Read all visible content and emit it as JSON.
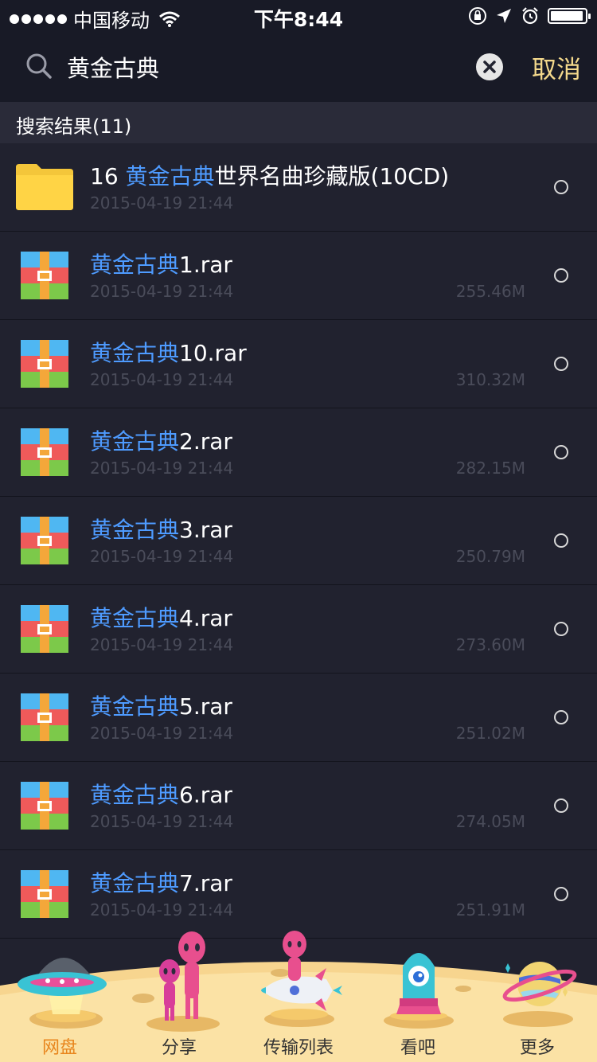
{
  "status_bar": {
    "carrier": "中国移动",
    "time": "下午8:44",
    "battery_level": 0.95
  },
  "search": {
    "query": "黄金古典",
    "cancel_label": "取消"
  },
  "results": {
    "header": "搜索结果(11)"
  },
  "files": [
    {
      "prefix": "16 ",
      "highlight": "黄金古典",
      "suffix": "世界名曲珍藏版(10CD)",
      "date": "2015-04-19 21:44",
      "size": "",
      "type": "folder"
    },
    {
      "prefix": "",
      "highlight": "黄金古典",
      "suffix": "1.rar",
      "date": "2015-04-19 21:44",
      "size": "255.46M",
      "type": "rar"
    },
    {
      "prefix": "",
      "highlight": "黄金古典",
      "suffix": "10.rar",
      "date": "2015-04-19 21:44",
      "size": "310.32M",
      "type": "rar"
    },
    {
      "prefix": "",
      "highlight": "黄金古典",
      "suffix": "2.rar",
      "date": "2015-04-19 21:44",
      "size": "282.15M",
      "type": "rar"
    },
    {
      "prefix": "",
      "highlight": "黄金古典",
      "suffix": "3.rar",
      "date": "2015-04-19 21:44",
      "size": "250.79M",
      "type": "rar"
    },
    {
      "prefix": "",
      "highlight": "黄金古典",
      "suffix": "4.rar",
      "date": "2015-04-19 21:44",
      "size": "273.60M",
      "type": "rar"
    },
    {
      "prefix": "",
      "highlight": "黄金古典",
      "suffix": "5.rar",
      "date": "2015-04-19 21:44",
      "size": "251.02M",
      "type": "rar"
    },
    {
      "prefix": "",
      "highlight": "黄金古典",
      "suffix": "6.rar",
      "date": "2015-04-19 21:44",
      "size": "274.05M",
      "type": "rar"
    },
    {
      "prefix": "",
      "highlight": "黄金古典",
      "suffix": "7.rar",
      "date": "2015-04-19 21:44",
      "size": "251.91M",
      "type": "rar"
    }
  ],
  "tabs": [
    {
      "label": "网盘",
      "icon": "ufo-icon",
      "active": true
    },
    {
      "label": "分享",
      "icon": "aliens-icon",
      "active": false
    },
    {
      "label": "传输列表",
      "icon": "rocket-icon",
      "active": false
    },
    {
      "label": "看吧",
      "icon": "alien-pod-icon",
      "active": false
    },
    {
      "label": "更多",
      "icon": "planet-icon",
      "active": false
    }
  ],
  "colors": {
    "background": "#21222f",
    "highlight": "#4e9bff",
    "cancel": "#f4d98c",
    "active_tab": "#e8861e"
  }
}
